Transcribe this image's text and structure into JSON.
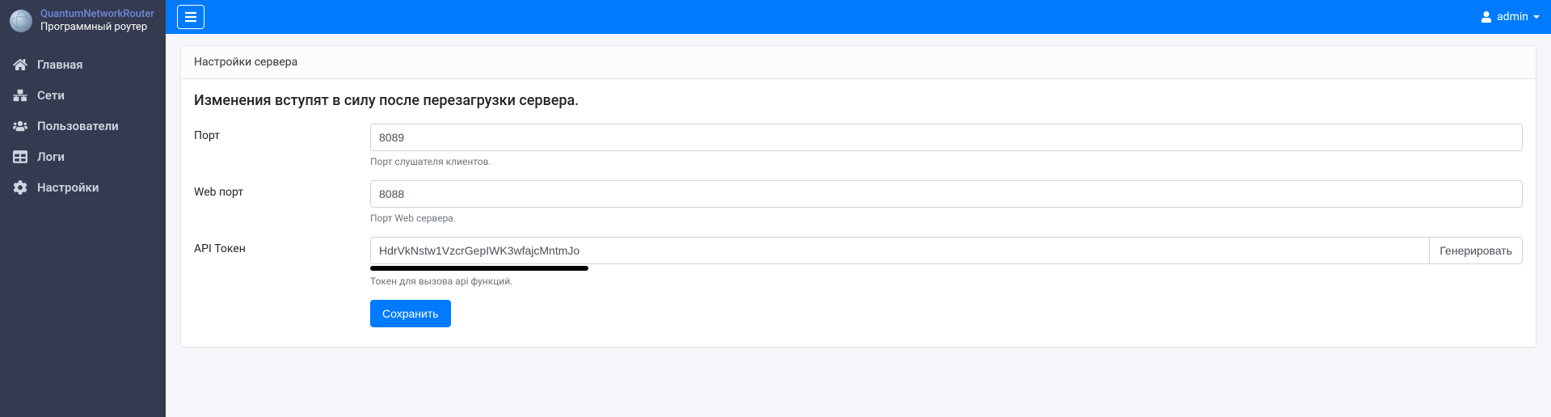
{
  "brand": {
    "title": "QuantumNetworkRouter",
    "subtitle": "Программный роутер"
  },
  "sidebar": {
    "items": [
      {
        "icon": "home",
        "label": "Главная"
      },
      {
        "icon": "network",
        "label": "Сети"
      },
      {
        "icon": "users",
        "label": "Пользователи"
      },
      {
        "icon": "table",
        "label": "Логи"
      },
      {
        "icon": "gear",
        "label": "Настройки"
      }
    ]
  },
  "topbar": {
    "user": "admin"
  },
  "card": {
    "header": "Настройки сервера",
    "notice": "Изменения вступят в силу после перезагрузки сервера.",
    "fields": {
      "port": {
        "label": "Порт",
        "value": "8089",
        "help": "Порт слушателя клиентов."
      },
      "web_port": {
        "label": "Web порт",
        "value": "8088",
        "help": "Порт Web сервера."
      },
      "api_token": {
        "label": "API Токен",
        "value": "HdrVkNstw1VzcrGepIWK3wfajcMntmJo",
        "help": "Токен для вызова api функций.",
        "generate": "Генерировать"
      }
    },
    "submit": "Сохранить"
  }
}
